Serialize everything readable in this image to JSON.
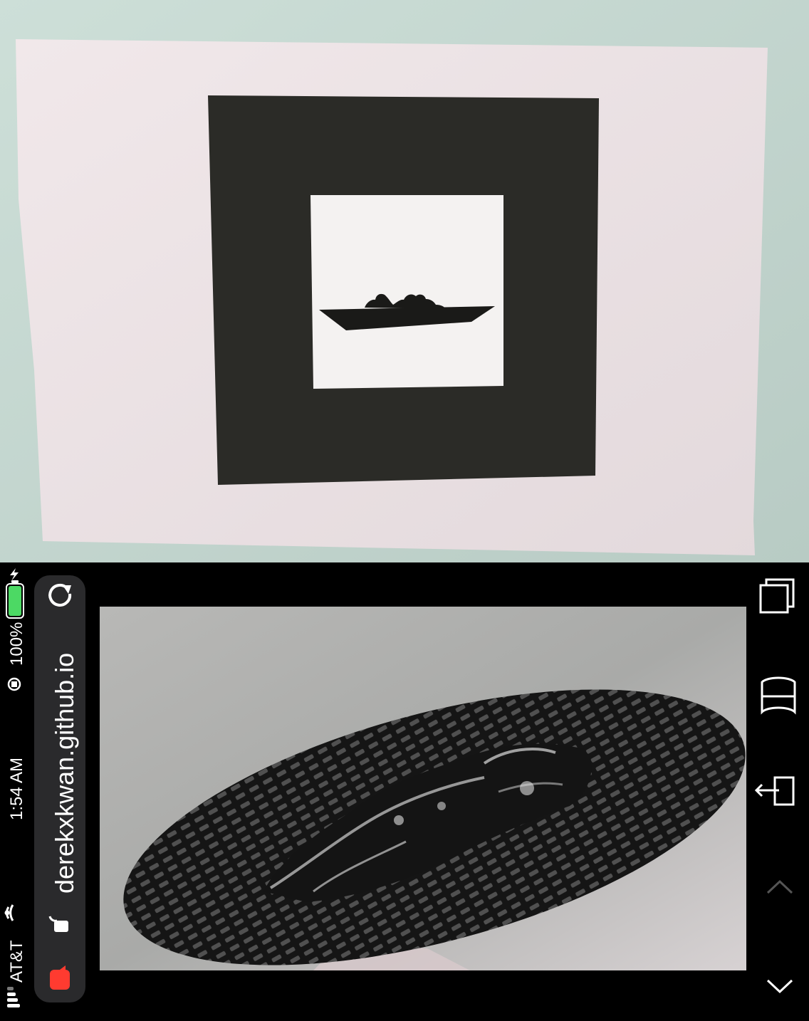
{
  "status_bar": {
    "carrier": "AT&T",
    "time": "1:54 AM",
    "battery_percent": "100%"
  },
  "browser": {
    "url": "derekxkwan.github.io"
  },
  "icons": {
    "signal": "signal-bars-icon",
    "wifi": "wifi-icon",
    "record": "screen-record-icon",
    "lock_rotation": "orientation-lock-icon",
    "battery": "battery-icon",
    "charging": "charging-bolt-icon",
    "secure": "lock-icon",
    "reload": "reload-icon",
    "tabs": "tabs-icon",
    "bookmarks": "bookmarks-icon",
    "share": "share-icon",
    "prev": "chevron-up-icon",
    "next": "chevron-down-icon"
  },
  "colors": {
    "wall": "#c3d6cf",
    "paper": "#ece3e6",
    "marker": "#2b2b27",
    "battery_green": "#4cd964",
    "record_red": "#ff3b30",
    "pill": "#2a2a2c"
  }
}
